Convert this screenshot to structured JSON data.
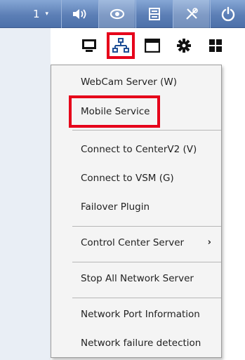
{
  "toolbar": {
    "selector_value": "1",
    "selector_arrow": "▾",
    "buttons": [
      {
        "icon": "speaker-icon"
      },
      {
        "icon": "eye-icon"
      },
      {
        "icon": "layout-icon"
      },
      {
        "icon": "tools-icon"
      },
      {
        "icon": "power-icon"
      }
    ]
  },
  "icon_row": [
    {
      "icon": "monitor-icon"
    },
    {
      "icon": "network-icon",
      "highlighted": true
    },
    {
      "icon": "window-icon"
    },
    {
      "icon": "gear-icon"
    },
    {
      "icon": "grid-icon"
    }
  ],
  "menu": {
    "items": [
      {
        "label": "WebCam Server (W)"
      },
      {
        "label": "Mobile Service",
        "highlighted": true
      },
      {
        "label": "Connect to CenterV2 (V)"
      },
      {
        "label": "Connect to VSM (G)"
      },
      {
        "label": "Failover Plugin"
      },
      {
        "label": "Control Center Server",
        "submenu_arrow": "›"
      },
      {
        "label": "Stop All Network Server"
      },
      {
        "label": "Network Port Information"
      },
      {
        "label": "Network failure detection"
      }
    ]
  },
  "colors": {
    "toolbar": "#5c7fb6",
    "highlight_box": "#e6001a",
    "menu_bg": "#f4f4f4"
  }
}
